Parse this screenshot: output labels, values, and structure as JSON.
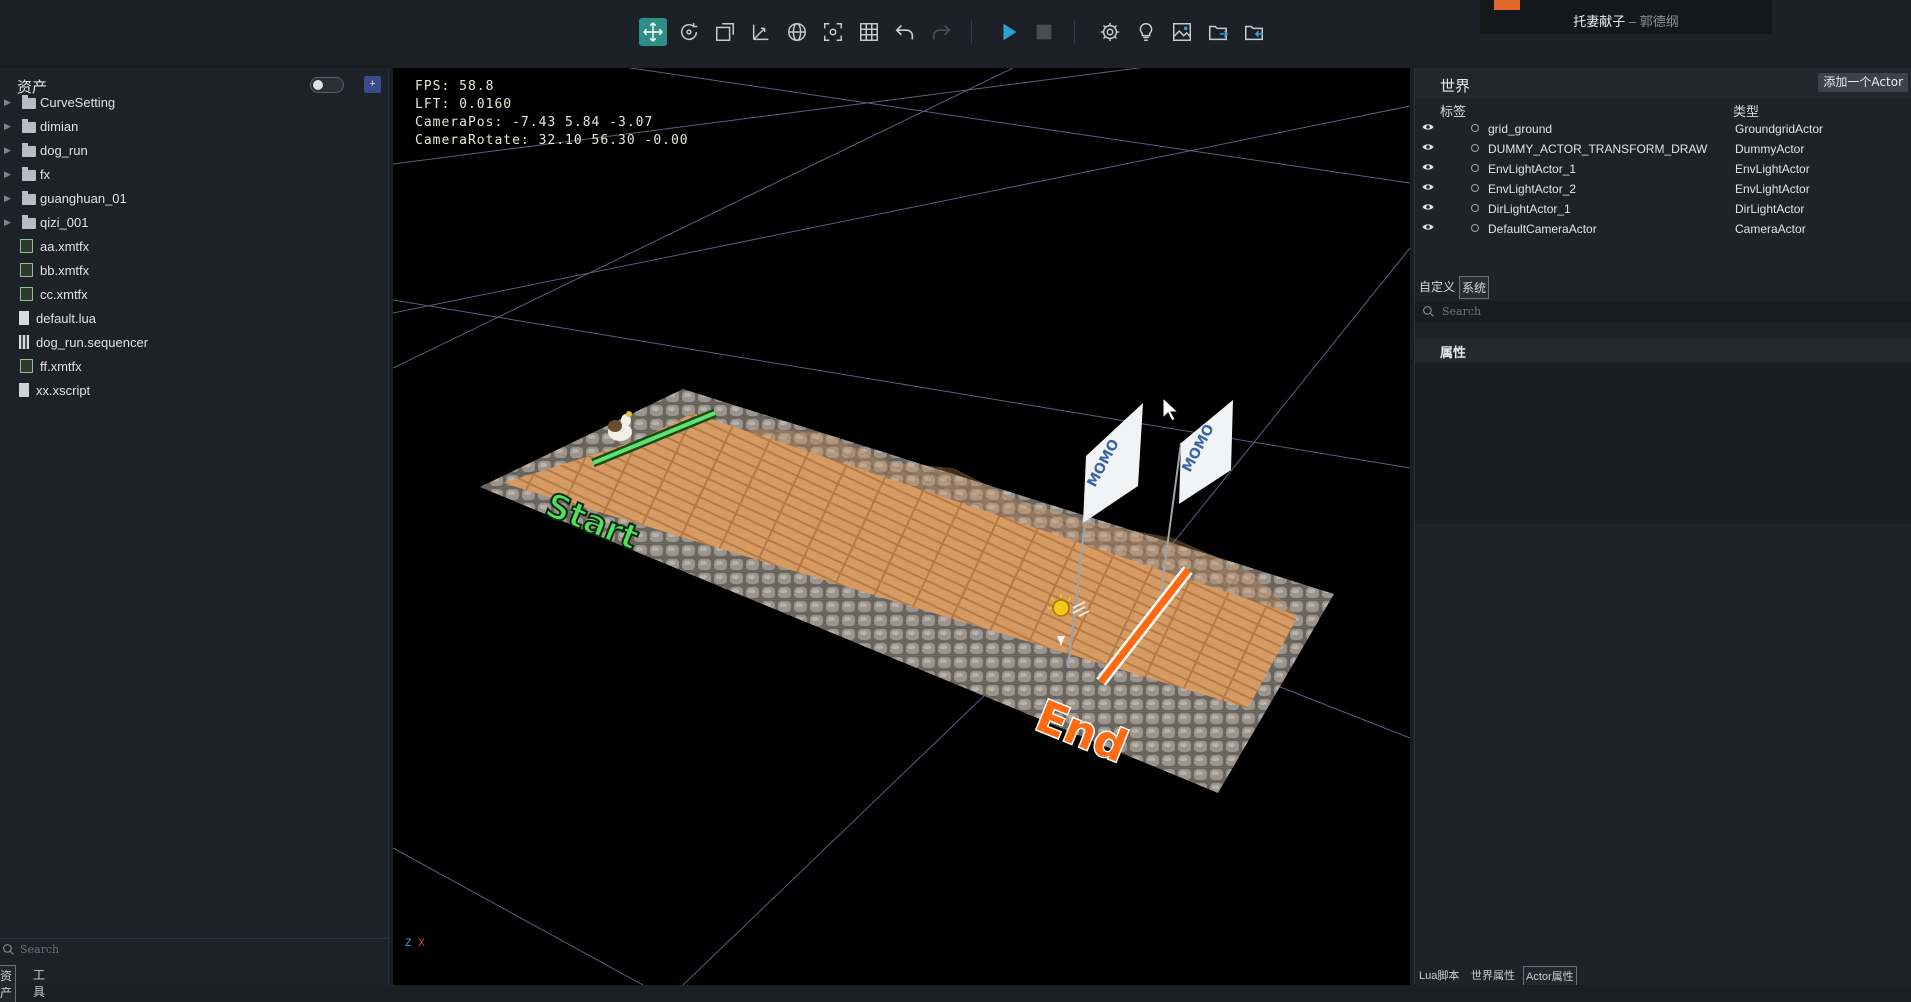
{
  "music": {
    "song": "托妻献子",
    "separator": "–",
    "artist": "郭德纲"
  },
  "toolbar": {
    "tools": [
      "move-icon",
      "rotate-icon",
      "scale-icon",
      "axis-icon",
      "globe-icon",
      "focus-icon",
      "grid-icon",
      "undo-icon",
      "redo-icon"
    ],
    "playback": [
      "play-icon",
      "stop-icon"
    ],
    "utilities": [
      "settings-icon",
      "light-bulb-icon",
      "image-icon",
      "export-folder-icon",
      "import-folder-icon"
    ]
  },
  "assets": {
    "title": "资产",
    "add_label": "+",
    "folders": [
      "CurveSetting",
      "dimian",
      "dog_run",
      "fx",
      "guanghuan_01",
      "qizi_001"
    ],
    "files": [
      {
        "name": "aa.xmtfx",
        "icon": "xmtfx-file-icon"
      },
      {
        "name": "bb.xmtfx",
        "icon": "xmtfx-file-icon"
      },
      {
        "name": "cc.xmtfx",
        "icon": "xmtfx-file-icon"
      },
      {
        "name": "default.lua",
        "icon": "lua-file-icon"
      },
      {
        "name": "dog_run.sequencer",
        "icon": "sequencer-file-icon"
      },
      {
        "name": "ff.xmtfx",
        "icon": "xmtfx-file-icon"
      },
      {
        "name": "xx.xscript",
        "icon": "xscript-file-icon"
      }
    ],
    "search_placeholder": "Search",
    "tabs": [
      "资产",
      "工具"
    ]
  },
  "viewport": {
    "stats": [
      "FPS: 58.8",
      "LFT: 0.0160",
      "CameraPos: -7.43 5.84 -3.07",
      "CameraRotate: 32.10 56.30 -0.00"
    ],
    "start_label": "Start",
    "end_label": "End",
    "flag_text": "MOMO",
    "axis_z": "Z",
    "axis_x": "X"
  },
  "world": {
    "title": "世界",
    "add_actor": "添加一个Actor",
    "col_tag": "标签",
    "col_type": "类型",
    "actors": [
      {
        "name": "grid_ground",
        "type": "GroundgridActor"
      },
      {
        "name": "DUMMY_ACTOR_TRANSFORM_DRAW",
        "type": "DummyActor"
      },
      {
        "name": "EnvLightActor_1",
        "type": "EnvLightActor"
      },
      {
        "name": "EnvLightActor_2",
        "type": "EnvLightActor"
      },
      {
        "name": "DirLightActor_1",
        "type": "DirLightActor"
      },
      {
        "name": "DefaultCameraActor",
        "type": "CameraActor"
      }
    ],
    "prop_tabs": [
      "自定义",
      "系统"
    ],
    "search_placeholder": "Search",
    "attr_title": "属性",
    "bottom_tabs": [
      "Lua脚本",
      "世界属性",
      "Actor属性"
    ]
  }
}
